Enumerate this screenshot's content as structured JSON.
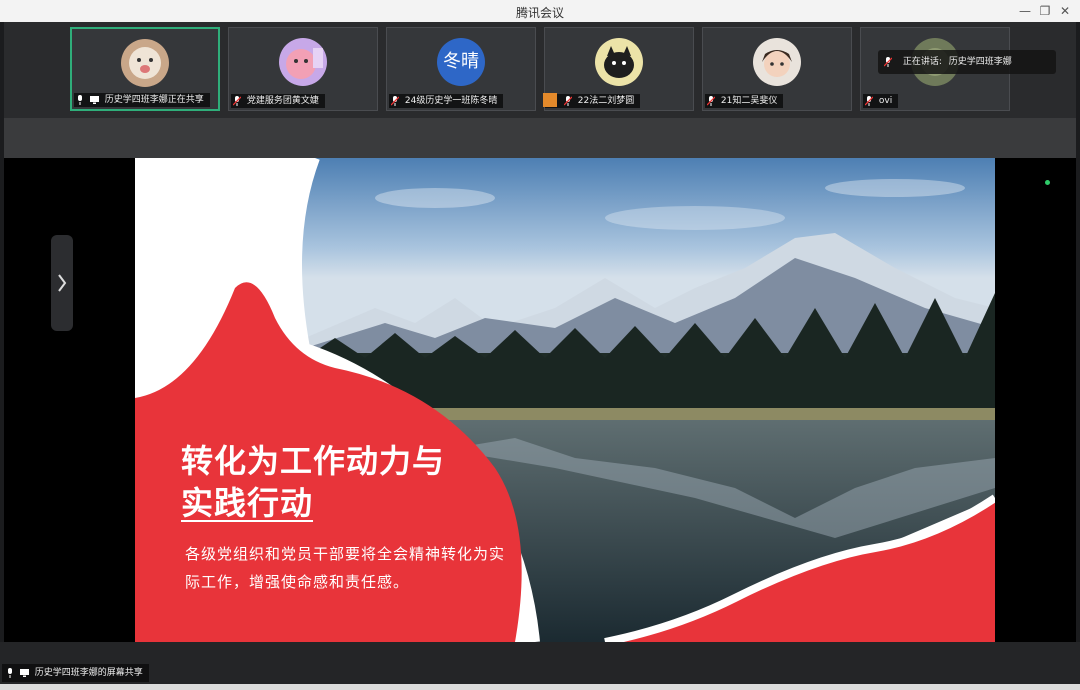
{
  "window": {
    "title": "腾讯会议",
    "controls": [
      "minimize-icon",
      "restore-icon",
      "close-icon"
    ]
  },
  "participants": [
    {
      "name": "历史学四班李娜正在共享",
      "avatar": "photo",
      "mic": "on",
      "sharing": true,
      "active": true
    },
    {
      "name": "党建服务团黄文婕",
      "avatar": "photo",
      "mic": "muted"
    },
    {
      "name": "24级历史学一班陈冬晴",
      "avatar": "text",
      "avatar_text": "冬晴",
      "avatar_color": "#2e67c7",
      "mic": "muted"
    },
    {
      "name": "22法二刘梦圆",
      "avatar": "photo",
      "mic": "muted",
      "contact_badge": true
    },
    {
      "name": "21知二吴斐仪",
      "avatar": "photo",
      "mic": "muted"
    },
    {
      "name": "ovi",
      "avatar": "photo",
      "mic": "muted"
    }
  ],
  "speaking": {
    "label": "正在讲话:",
    "name": "历史学四班李娜"
  },
  "slide": {
    "title_line1": "转化为工作动力与",
    "title_line2": "实践行动",
    "body": "各级党组织和党员干部要将全会精神转化为实际工作，增强使命感和责任感。",
    "accent_color": "#e8343a"
  },
  "bottom": {
    "share_label": "历史学四班李娜的屏幕共享"
  }
}
